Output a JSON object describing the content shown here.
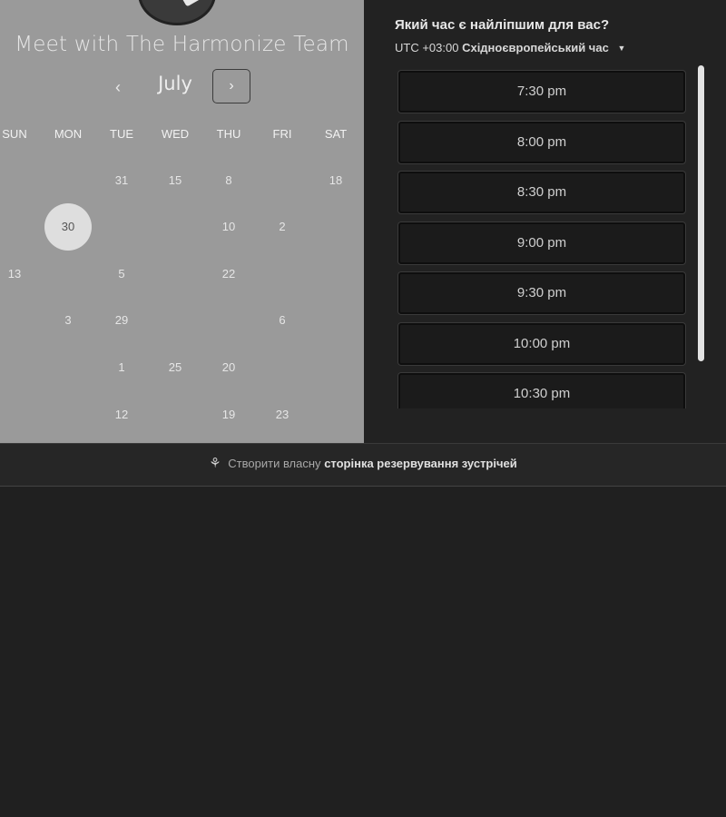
{
  "booking": {
    "title": "Meet with The Harmonize Team",
    "month": "July"
  },
  "calendar": {
    "weekdays": [
      "SUN",
      "MON",
      "TUE",
      "WED",
      "THU",
      "FRI",
      "SAT"
    ],
    "rows": [
      [
        "",
        "",
        "31",
        "15",
        "8",
        "",
        "18"
      ],
      [
        "",
        "30",
        "",
        "",
        "10",
        "2",
        ""
      ],
      [
        "13",
        "",
        "5",
        "",
        "22",
        "",
        ""
      ],
      [
        "",
        "3",
        "29",
        "",
        "",
        "6",
        ""
      ],
      [
        "",
        "",
        "1",
        "25",
        "20",
        "",
        ""
      ],
      [
        "",
        "",
        "12",
        "",
        "19",
        "23",
        ""
      ]
    ],
    "selected_day": "30"
  },
  "times": {
    "question": "Який час є найліпшим для вас?",
    "timezone_offset": "UTC +03:00",
    "timezone_name": "Східноєвропейський час",
    "slots": [
      "7:30 pm",
      "8:00 pm",
      "8:30 pm",
      "9:00 pm",
      "9:30 pm",
      "10:00 pm",
      "10:30 pm"
    ]
  },
  "footer": {
    "text_prefix": "Створити власну",
    "text_link": "сторінка резервування зустрічей"
  },
  "icons": {
    "prev": "chevron-left-icon",
    "next": "chevron-right-icon",
    "tz_caret": "caret-down-icon",
    "brand": "brand-logo-icon"
  }
}
